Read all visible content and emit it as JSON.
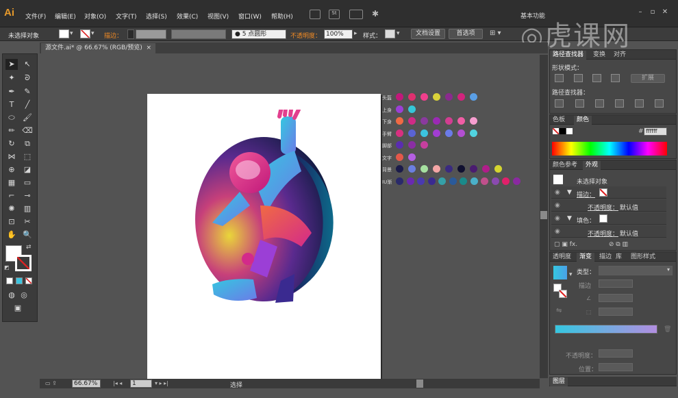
{
  "app": {
    "logo": "Ai"
  },
  "menu": [
    "文件(F)",
    "编辑(E)",
    "对象(O)",
    "文字(T)",
    "选择(S)",
    "效果(C)",
    "视图(V)",
    "窗口(W)",
    "帮助(H)"
  ],
  "workspace": "基本功能",
  "watermark": "虎课网",
  "control_bar": {
    "selection": "未选择对象",
    "stroke_label": "描边：",
    "brush": "5 点圆形",
    "opacity_label": "不透明度：",
    "opacity_value": "100%",
    "style_label": "样式：",
    "doc_setup": "文档设置",
    "preferences": "首选项"
  },
  "document_tab": {
    "title": "源文件.ai* @ 66.67% (RGB/预览)",
    "close": "×"
  },
  "status_bar": {
    "zoom": "66.67%",
    "page": "1",
    "tool": "选择"
  },
  "swatch_rows": [
    {
      "label": "头盔",
      "colors": [
        "#c2187b",
        "#e0306f",
        "#f03f8c",
        "#d9d23a",
        "#8a2a8e",
        "#d3237d",
        "#5a9fe6"
      ]
    },
    {
      "label": "上身",
      "colors": [
        "#9b3fd6",
        "#35c7d8"
      ]
    },
    {
      "label": "下身",
      "colors": [
        "#f06a44",
        "#cf2b86",
        "#8a3a9e",
        "#9a2ab4",
        "#d23d91",
        "#f15da5",
        "#f79ed0"
      ]
    },
    {
      "label": "手臂",
      "colors": [
        "#d83080",
        "#5a63d4",
        "#3cc4df",
        "#a23dd2",
        "#6b7be8",
        "#b34fd2",
        "#51d3e0"
      ]
    },
    {
      "label": "脚部",
      "colors": [
        "#5a2db0",
        "#8a2ea4",
        "#c63f9e"
      ]
    },
    {
      "label": "文字",
      "colors": [
        "#e4584a",
        "#b55fe3"
      ]
    },
    {
      "label": "背景",
      "colors": [
        "#1b1b4a",
        "#6b7fe0",
        "#a6e0a0",
        "#f4a6a6",
        "#3a2a80",
        "#101030",
        "#4a1c70",
        "#b01d8a",
        "#d4d530"
      ]
    },
    {
      "label": "IU渐",
      "colors": [
        "#2a2a6a",
        "#6a2ab0",
        "#4a3ab0",
        "#3a2a90",
        "#35a0a8",
        "#2a5a9a",
        "#1a8a8a",
        "#4ab0c8",
        "#c0508c",
        "#8a4ab0",
        "#e0206a",
        "#8a2aa0"
      ]
    }
  ],
  "pathfinder": {
    "tabs": [
      "路径查找器",
      "变换",
      "对齐"
    ],
    "shape_modes_label": "形状模式：",
    "expand": "扩展",
    "pathfinders_label": "路径查找器："
  },
  "color_panel": {
    "tabs": [
      "色板",
      "颜色"
    ],
    "hex": "ffffff"
  },
  "appearance": {
    "tabs": [
      "颜色参考",
      "外观"
    ],
    "object": "未选择对象",
    "stroke_label": "描边：",
    "opacity_label": "不透明度：",
    "opacity_value": "默认值",
    "fill_label": "填色：",
    "opacity_label2": "不透明度：",
    "opacity_value2": "默认值"
  },
  "gradient": {
    "tabs": [
      "透明度",
      "渐变",
      "描边",
      "库",
      "图形样式"
    ],
    "type_label": "类型：",
    "stroke_label": "描边",
    "opacity_label": "不透明度：",
    "position_label": "位置："
  },
  "layers": {
    "tab": "图层"
  },
  "colors": {
    "accent_orange": "#f08a24",
    "gradient_start": "#35c7e0",
    "gradient_end": "#b28ee0"
  }
}
